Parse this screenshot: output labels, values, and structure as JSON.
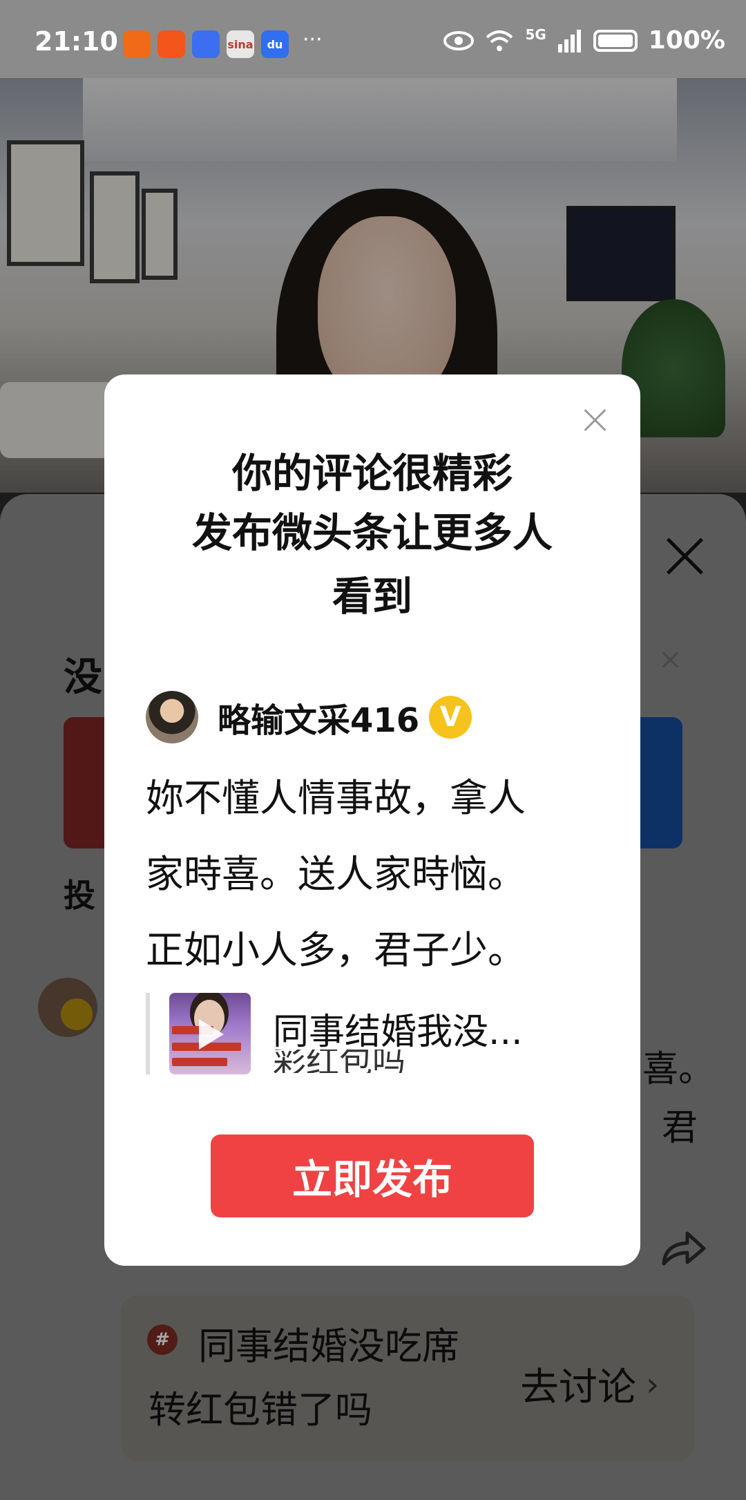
{
  "status_bar": {
    "time": "21:10",
    "app_icons": [
      "kuaishou-icon",
      "kuaishou-icon",
      "bear-app-icon",
      "sina-icon",
      "baidu-icon"
    ],
    "app_icon_labels": [
      "",
      "",
      "",
      "sina",
      "du"
    ],
    "more": "···",
    "network": "5G",
    "battery": "100%"
  },
  "modal": {
    "title_line1": "你的评论很精彩",
    "title_line2": "发布微头条让更多人",
    "title_line3": "看到",
    "user_name": "略输文采416",
    "verified_badge": "V",
    "comment_lines": [
      "妳不懂人情事故，拿人",
      "家時喜。送人家時恼。",
      "正如小人多，君子少。"
    ],
    "quote_title": "同事结婚我没...",
    "quote_subtitle": "彩红包吗",
    "publish_button": "立即发布"
  },
  "background": {
    "heading_fragment": "没",
    "tou_fragment": "投",
    "comment_fragment_1": "喜。",
    "comment_fragment_2": "君",
    "topic_badge": "#",
    "topic_title": "同事结婚没吃席转红包错了吗",
    "topic_link": "去讨论",
    "topic_chevron": "›"
  },
  "colors": {
    "publish_button": "#f04242",
    "verified_badge": "#f6c21c",
    "status_bar": "#8b8b8b"
  }
}
